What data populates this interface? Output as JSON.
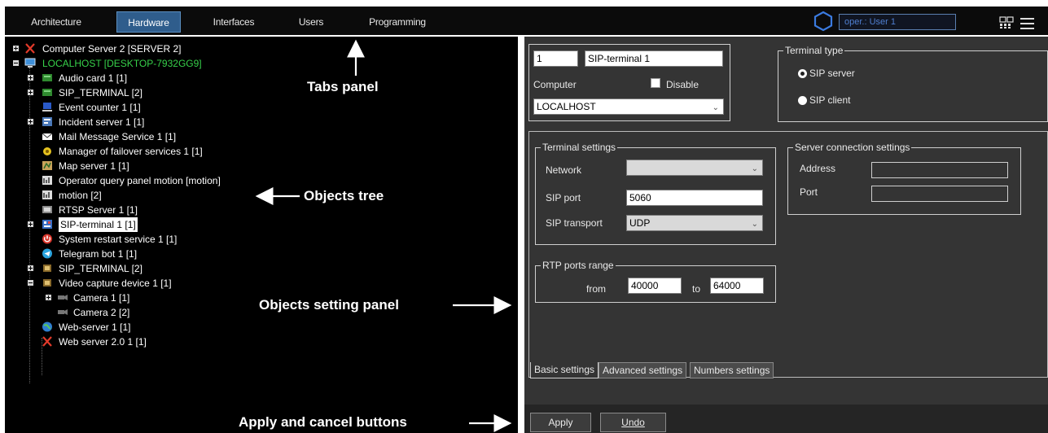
{
  "tabs": [
    "Architecture",
    "Hardware",
    "Interfaces",
    "Users",
    "Programming"
  ],
  "active_tab": "Hardware",
  "operator_field": "oper.: User 1",
  "tree": [
    {
      "label": "Computer Server 2 [SERVER 2]"
    },
    {
      "label": "LOCALHOST [DESKTOP-7932GG9]"
    },
    {
      "label": "Audio card 1 [1]"
    },
    {
      "label": "SIP_TERMINAL [2]"
    },
    {
      "label": "Event counter 1 [1]"
    },
    {
      "label": "Incident server 1 [1]"
    },
    {
      "label": "Mail Message Service 1 [1]"
    },
    {
      "label": "Manager of failover services 1 [1]"
    },
    {
      "label": "Map server 1 [1]"
    },
    {
      "label": "Operator query panel motion [motion]"
    },
    {
      "label": "motion [2]"
    },
    {
      "label": "RTSP Server 1 [1]"
    },
    {
      "label": "SIP-terminal 1 [1]"
    },
    {
      "label": "System restart service 1 [1]"
    },
    {
      "label": "Telegram bot 1 [1]"
    },
    {
      "label": "SIP_TERMINAL [2]"
    },
    {
      "label": "Video capture device 1 [1]"
    },
    {
      "label": "Camera 1 [1]"
    },
    {
      "label": "Camera 2 [2]"
    },
    {
      "label": "Web-server 1 [1]"
    },
    {
      "label": "Web server 2.0 1 [1]"
    }
  ],
  "annotations": {
    "tabs_panel": "Tabs panel",
    "objects_tree": "Objects tree",
    "objects_setting_panel": "Objects setting panel",
    "apply_cancel": "Apply and cancel buttons"
  },
  "object": {
    "id": "1",
    "name": "SIP-terminal 1",
    "computer_label": "Computer",
    "disable_label": "Disable",
    "computer_value": "LOCALHOST"
  },
  "terminal_type": {
    "legend": "Terminal type",
    "options": [
      "SIP server",
      "SIP client"
    ],
    "selected": "SIP server"
  },
  "terminal_settings": {
    "legend": "Terminal settings",
    "network_label": "Network",
    "network_value": "",
    "sip_port_label": "SIP port",
    "sip_port_value": "5060",
    "sip_transport_label": "SIP transport",
    "sip_transport_value": "UDP"
  },
  "server_connection": {
    "legend": "Server connection settings",
    "address_label": "Address",
    "address_value": "",
    "port_label": "Port",
    "port_value": ""
  },
  "rtp": {
    "legend": "RTP ports range",
    "from_label": "from",
    "from_value": "40000",
    "to_label": "to",
    "to_value": "64000"
  },
  "bottom_tabs": [
    "Basic settings",
    "Advanced settings",
    "Numbers settings"
  ],
  "active_bottom_tab": "Basic settings",
  "buttons": {
    "apply": "Apply",
    "undo": "Undo"
  }
}
